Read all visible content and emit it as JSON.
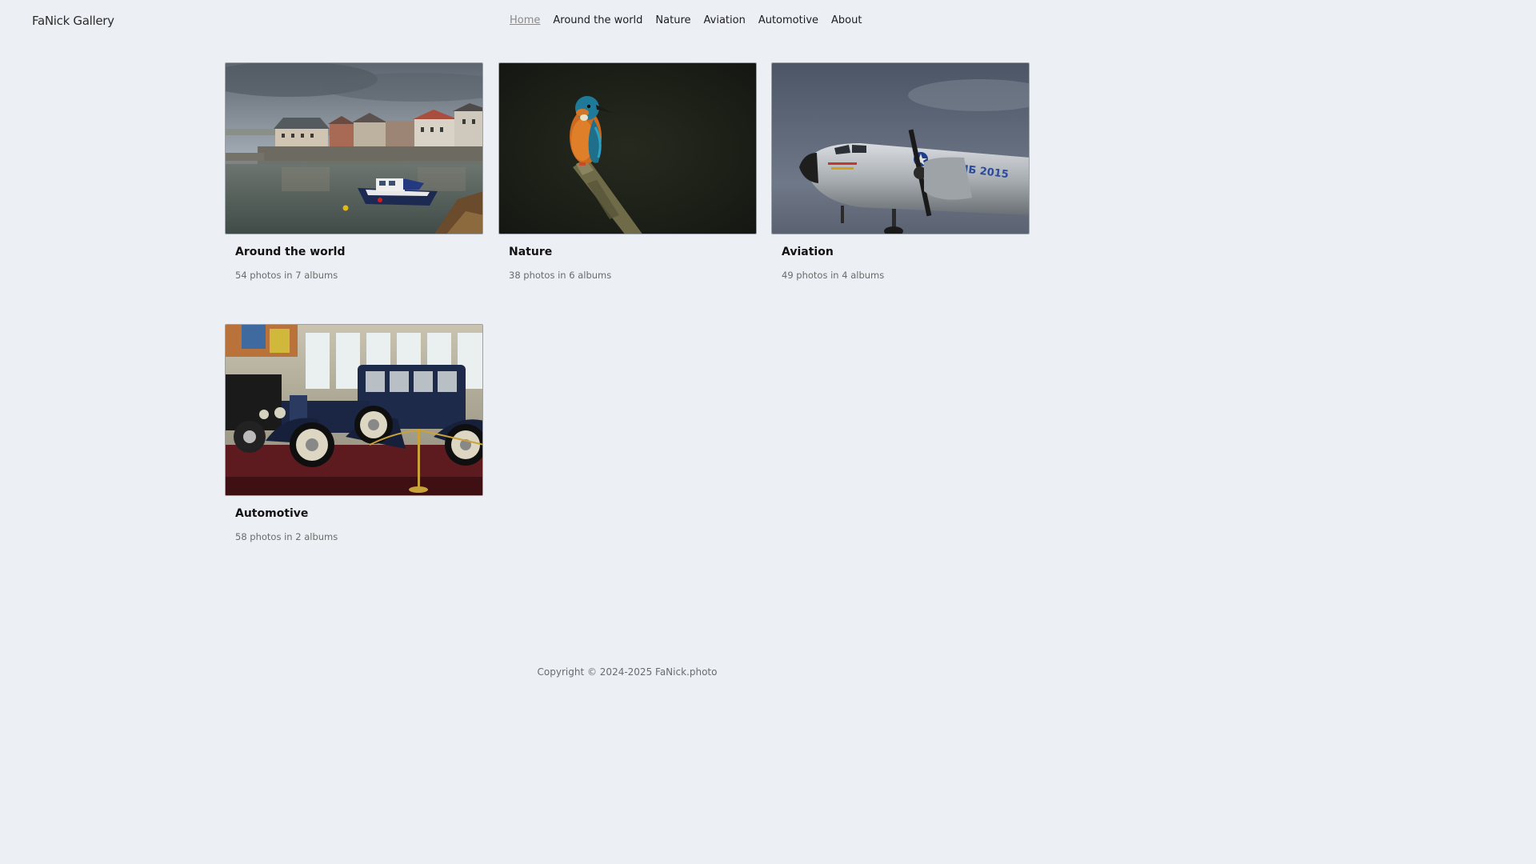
{
  "site": {
    "title": "FaNick Gallery"
  },
  "nav": {
    "items": [
      {
        "label": "Home",
        "active": true
      },
      {
        "label": "Around the world",
        "active": false
      },
      {
        "label": "Nature",
        "active": false
      },
      {
        "label": "Aviation",
        "active": false
      },
      {
        "label": "Automotive",
        "active": false
      },
      {
        "label": "About",
        "active": false
      }
    ]
  },
  "categories": [
    {
      "title": "Around the world",
      "meta": "54 photos in 7 albums",
      "image": "harbour-boat-photo"
    },
    {
      "title": "Nature",
      "meta": "38 photos in 6 albums",
      "image": "kingfisher-photo"
    },
    {
      "title": "Aviation",
      "meta": "49 photos in 4 albums",
      "image": "vintage-aircraft-photo",
      "image_text": "АЛСИБ 2015"
    },
    {
      "title": "Automotive",
      "meta": "58 photos in 2 albums",
      "image": "vintage-car-photo"
    }
  ],
  "footer": {
    "copyright": "Copyright © 2024-2025 FaNick.photo"
  }
}
